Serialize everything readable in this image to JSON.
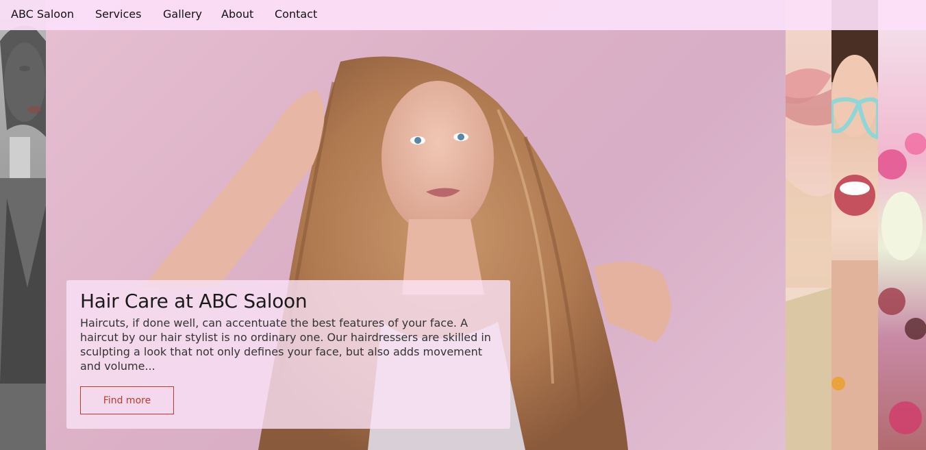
{
  "nav": {
    "brand": "ABC Saloon",
    "links": [
      "Services",
      "Gallery",
      "About",
      "Contact"
    ]
  },
  "hero": {
    "title": "Hair Care at ABC Saloon",
    "body": "Haircuts, if done well, can accentuate the best features of your face. A haircut by our hair stylist is no ordinary one. Our hairdressers are skilled in sculpting a look that not only defines your face, but also adds movement and volume...",
    "button_label": "Find more"
  },
  "colors": {
    "navbar_bg": "#fce0f8",
    "card_bg": "#fae2f6",
    "button_accent": "#c0392b",
    "hero_bg": "#dbb0c6"
  }
}
